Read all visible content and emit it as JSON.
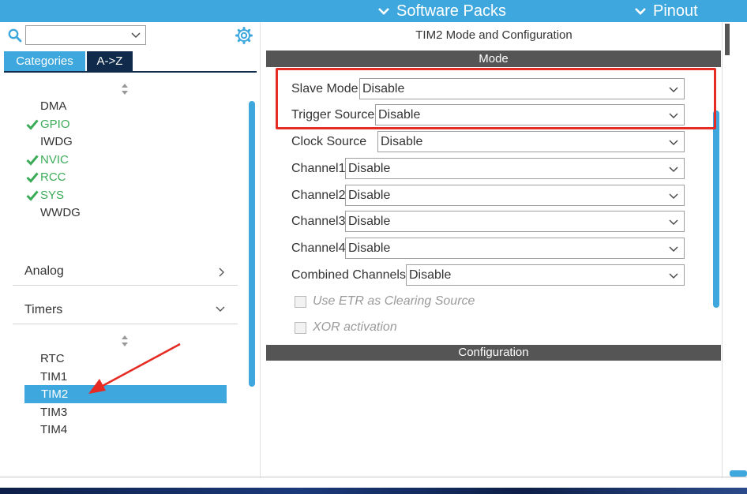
{
  "topbar": {
    "software_packs": "Software Packs",
    "pinout": "Pinout"
  },
  "colors": {
    "accent": "#3ea7dd",
    "dark_tab": "#0f2a4a",
    "header_gray": "#555555",
    "check_green": "#3cab58",
    "annotation_red": "#e52b24"
  },
  "left": {
    "search": {
      "value": ""
    },
    "tabs": {
      "categories": "Categories",
      "az": "A->Z"
    },
    "system_core_items": [
      {
        "label": "DMA",
        "configured": false
      },
      {
        "label": "GPIO",
        "configured": true
      },
      {
        "label": "IWDG",
        "configured": false
      },
      {
        "label": "NVIC",
        "configured": true
      },
      {
        "label": "RCC",
        "configured": true
      },
      {
        "label": "SYS",
        "configured": true
      },
      {
        "label": "WWDG",
        "configured": false
      }
    ],
    "sections": {
      "analog": "Analog",
      "timers": "Timers"
    },
    "timer_items": [
      "RTC",
      "TIM1",
      "TIM2",
      "TIM3",
      "TIM4"
    ],
    "selected_item": "TIM2"
  },
  "right": {
    "title": "TIM2 Mode and Configuration",
    "mode_header": "Mode",
    "config_header": "Configuration",
    "fields": {
      "slave_mode": {
        "label": "Slave Mode",
        "value": "Disable"
      },
      "trigger_source": {
        "label": "Trigger Source",
        "value": "Disable"
      },
      "clock_source": {
        "label": "Clock Source",
        "value": "Disable"
      },
      "channel1": {
        "label": "Channel1",
        "value": "Disable"
      },
      "channel2": {
        "label": "Channel2",
        "value": "Disable"
      },
      "channel3": {
        "label": "Channel3",
        "value": "Disable"
      },
      "channel4": {
        "label": "Channel4",
        "value": "Disable"
      },
      "combined_channels": {
        "label": "Combined Channels",
        "value": "Disable"
      }
    },
    "checkboxes": {
      "use_etr": {
        "label": "Use ETR as Clearing Source",
        "checked": false,
        "enabled": false
      },
      "xor_activation": {
        "label": "XOR activation",
        "checked": false,
        "enabled": false
      }
    }
  }
}
